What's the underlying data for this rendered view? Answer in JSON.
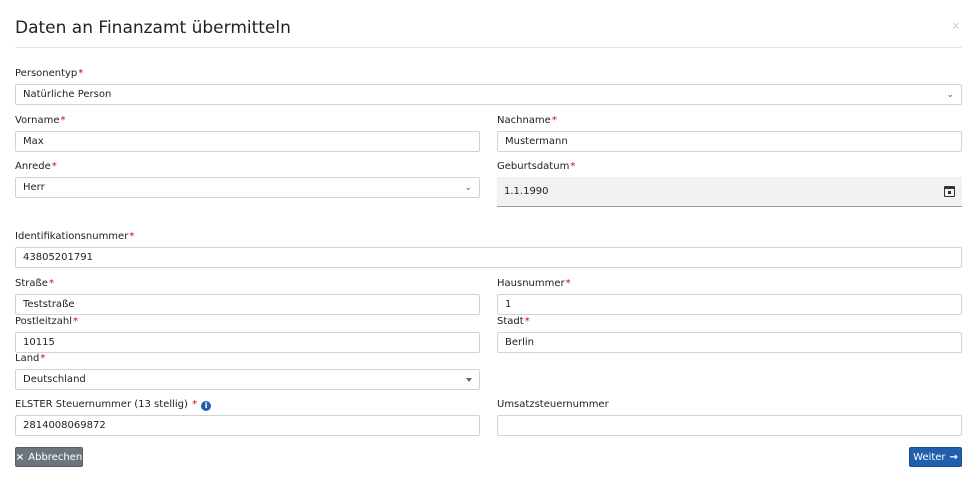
{
  "modal": {
    "title": "Daten an Finanzamt übermitteln",
    "close_icon": "×"
  },
  "form": {
    "personentyp": {
      "label": "Personentyp",
      "value": "Natürliche Person"
    },
    "vorname": {
      "label": "Vorname",
      "value": "Max"
    },
    "nachname": {
      "label": "Nachname",
      "value": "Mustermann"
    },
    "anrede": {
      "label": "Anrede",
      "value": "Herr"
    },
    "geburtsdatum": {
      "label": "Geburtsdatum",
      "value": "1.1.1990"
    },
    "identifikationsnummer": {
      "label": "Identifikationsnummer",
      "value": "43805201791"
    },
    "strasse": {
      "label": "Straße",
      "value": "Teststraße"
    },
    "hausnummer": {
      "label": "Hausnummer",
      "value": "1"
    },
    "postleitzahl": {
      "label": "Postleitzahl",
      "value": "10115"
    },
    "stadt": {
      "label": "Stadt",
      "value": "Berlin"
    },
    "land": {
      "label": "Land",
      "value": "Deutschland"
    },
    "elster": {
      "label": "ELSTER Steuernummer (13 stellig)",
      "value": "2814008069872"
    },
    "umsatzsteuer": {
      "label": "Umsatzsteuernummer",
      "value": ""
    },
    "required_mark": "*"
  },
  "buttons": {
    "cancel": {
      "label": "Abbrechen",
      "icon": "×"
    },
    "next": {
      "label": "Weiter",
      "icon": "→"
    }
  },
  "colors": {
    "primary": "#1f5fae",
    "secondary": "#6c757d",
    "required": "#d0021b"
  }
}
